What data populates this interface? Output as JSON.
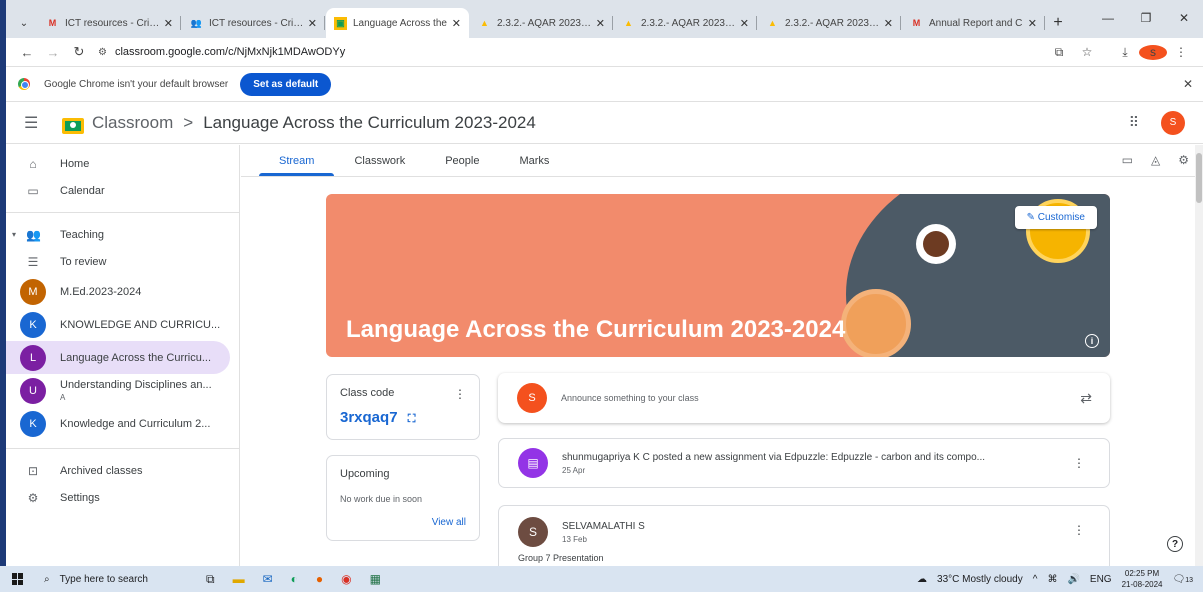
{
  "browser": {
    "tabs": [
      {
        "icon": "gmail-icon",
        "title": "ICT resources - Criter",
        "active": false
      },
      {
        "icon": "people-icon",
        "title": "ICT resources - Criter",
        "active": false
      },
      {
        "icon": "classroom-icon",
        "title": "Language Across the",
        "active": true
      },
      {
        "icon": "drive-icon",
        "title": "2.3.2.- AQAR 2023 -2",
        "active": false
      },
      {
        "icon": "drive-icon",
        "title": "2.3.2.- AQAR 2023 -2",
        "active": false
      },
      {
        "icon": "drive-icon",
        "title": "2.3.2.- AQAR 2023 -2",
        "active": false
      },
      {
        "icon": "gmail-icon",
        "title": "Annual Report and C",
        "active": false
      }
    ],
    "url": "classroom.google.com/c/NjMxNjk1MDAwODYy",
    "profile_initial": "s",
    "infobar_text": "Google Chrome isn't your default browser",
    "set_default_label": "Set as default"
  },
  "header": {
    "app_name": "Classroom",
    "separator": ">",
    "class_name": "Language Across the Curriculum 2023-2024",
    "avatar_initial": "S"
  },
  "sidebar": {
    "home": "Home",
    "calendar": "Calendar",
    "teaching": "Teaching",
    "to_review": "To review",
    "classes": [
      {
        "initial": "M",
        "name": "M.Ed.2023-2024",
        "color": "#c26401",
        "sub": ""
      },
      {
        "initial": "K",
        "name": "KNOWLEDGE AND CURRICU...",
        "color": "#1967d2",
        "sub": ""
      },
      {
        "initial": "L",
        "name": "Language Across the Curricu...",
        "color": "#7b1fa2",
        "sub": ""
      },
      {
        "initial": "U",
        "name": "Understanding Disciplines an...",
        "color": "#7b1fa2",
        "sub": "A"
      },
      {
        "initial": "K",
        "name": "Knowledge and Curriculum 2...",
        "color": "#1967d2",
        "sub": ""
      }
    ],
    "archived": "Archived classes",
    "settings": "Settings"
  },
  "tabs": {
    "stream": "Stream",
    "classwork": "Classwork",
    "people": "People",
    "marks": "Marks"
  },
  "banner": {
    "title": "Language Across the Curriculum 2023-2024",
    "customise_label": "Customise"
  },
  "class_code": {
    "label": "Class code",
    "value": "3rxqaq7"
  },
  "upcoming": {
    "label": "Upcoming",
    "empty_text": "No work due in soon",
    "view_all": "View all"
  },
  "announce": {
    "initial": "S",
    "placeholder": "Announce something to your class"
  },
  "posts": [
    {
      "title": "shunmugapriya K C posted a new assignment via Edpuzzle: Edpuzzle - carbon and its compo...",
      "date": "25 Apr"
    },
    {
      "initial": "S",
      "title": "SELVAMALATHI S",
      "date": "13 Feb",
      "body": "Group 7 Presentation"
    }
  ],
  "taskbar": {
    "search_placeholder": "Type here to search",
    "weather": "33°C  Mostly cloudy",
    "lang": "ENG",
    "time": "02:25 PM",
    "date": "21-08-2024",
    "notif_count": "13"
  }
}
